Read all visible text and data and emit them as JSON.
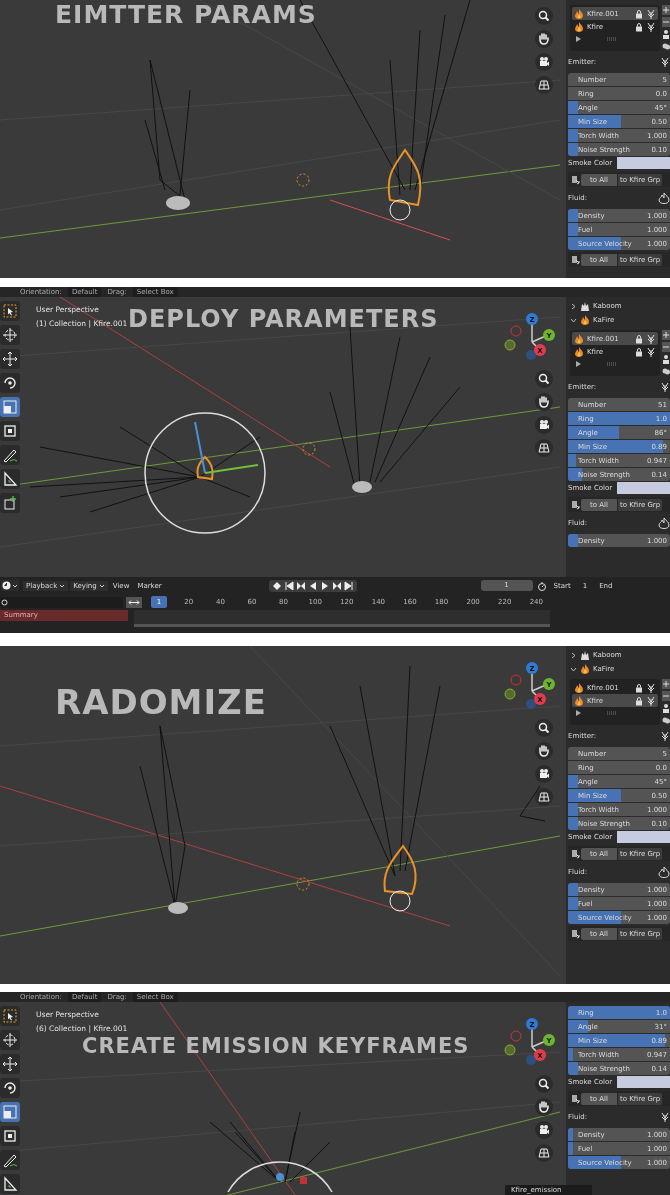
{
  "panels": [
    {
      "title": "EIMTTER PARAMS",
      "sidebar": [
        {
          "kind": "object_list",
          "items": [
            {
              "label": "Kfire.001",
              "selected": true
            },
            {
              "label": "Kfire",
              "selected": false
            }
          ]
        },
        {
          "kind": "heading",
          "label": "Emitter:"
        },
        {
          "kind": "field",
          "label": "Number",
          "value": "5",
          "level": 0
        },
        {
          "kind": "field",
          "label": "Ring",
          "value": "0.0",
          "level": 0
        },
        {
          "kind": "field",
          "label": "Angle",
          "value": "45°",
          "level": 0.1
        },
        {
          "kind": "field",
          "label": "Min Size",
          "value": "0.50",
          "level": 0.52
        },
        {
          "kind": "field",
          "label": "Torch Width",
          "value": "1.000",
          "level": 0.1
        },
        {
          "kind": "field",
          "label": "Noise Strength",
          "value": "0.10",
          "level": 0.1
        },
        {
          "kind": "color",
          "label": "Smoke Color"
        },
        {
          "kind": "buttons",
          "labels": [
            "to All",
            "to Kfire Grp"
          ]
        },
        {
          "kind": "heading",
          "label": "Fluid:"
        },
        {
          "kind": "field",
          "label": "Density",
          "value": "1.000",
          "level": 0.1
        },
        {
          "kind": "field",
          "label": "Fuel",
          "value": "1.000",
          "level": 0.1
        },
        {
          "kind": "field",
          "label": "Source Velocity",
          "value": "1.000",
          "level": 0.52
        },
        {
          "kind": "buttons",
          "labels": [
            "to All",
            "to Kfire Grp"
          ]
        }
      ]
    },
    {
      "toolbar": {
        "orientation_label": "Orientation:",
        "orientation": "Default",
        "drag_label": "Drag:",
        "drag": "Select Box"
      },
      "view_info": [
        "User Perspective",
        "(1) Collection | Kfire.001"
      ],
      "title": "DEPLOY PARAMETERS",
      "gizmo": [
        "Z",
        "Y",
        "X"
      ],
      "tools": [
        {
          "selected": false
        },
        {
          "selected": false
        },
        {
          "selected": false
        },
        {
          "selected": false
        },
        {
          "selected": true
        },
        {
          "selected": false
        },
        {
          "selected": false
        },
        {
          "selected": false
        },
        {
          "selected": false
        }
      ],
      "sidebar": [
        {
          "kind": "collection",
          "label": "Kaboom",
          "expanded": false
        },
        {
          "kind": "collection",
          "label": "KaFire",
          "expanded": true
        },
        {
          "kind": "object_list",
          "items": [
            {
              "label": "Kfire.001",
              "selected": true
            },
            {
              "label": "Kfire",
              "selected": false
            }
          ]
        },
        {
          "kind": "heading",
          "label": "Emitter:"
        },
        {
          "kind": "field",
          "label": "Number",
          "value": "51",
          "level": 0
        },
        {
          "kind": "field",
          "label": "Ring",
          "value": "1.0",
          "level": 1
        },
        {
          "kind": "field",
          "label": "Angle",
          "value": "86°",
          "level": 0.5
        },
        {
          "kind": "field",
          "label": "Min Size",
          "value": "0.89",
          "level": 0.93
        },
        {
          "kind": "field",
          "label": "Torch Width",
          "value": "0.947",
          "level": 0.08
        },
        {
          "kind": "field",
          "label": "Noise Strength",
          "value": "0.14",
          "level": 0.14
        },
        {
          "kind": "color",
          "label": "Smoke Color"
        },
        {
          "kind": "buttons",
          "labels": [
            "to All",
            "to Kfire Grp"
          ]
        },
        {
          "kind": "heading",
          "label": "Fluid:"
        },
        {
          "kind": "field",
          "label": "Density",
          "value": "1.000",
          "level": 0.1
        }
      ],
      "timeline": {
        "menus": [
          {
            "label": "Playback",
            "dropdown": true
          },
          {
            "label": "Keying",
            "dropdown": true
          },
          {
            "label": "View",
            "dropdown": false
          },
          {
            "label": "Marker",
            "dropdown": false
          }
        ],
        "current_frame": "1",
        "start_label": "Start",
        "start": "1",
        "end_label": "End",
        "frame_marker": "1",
        "ruler": [
          "20",
          "40",
          "60",
          "80",
          "100",
          "120",
          "140",
          "160",
          "180",
          "200",
          "220",
          "240"
        ],
        "channels": [
          "Summary"
        ]
      }
    },
    {
      "title": "RADOMIZE",
      "gizmo": [
        "Z",
        "Y",
        "X"
      ],
      "sidebar": [
        {
          "kind": "collection",
          "label": "Kaboom",
          "expanded": false
        },
        {
          "kind": "collection",
          "label": "KaFire",
          "expanded": true
        },
        {
          "kind": "object_list",
          "items": [
            {
              "label": "Kfire.001",
              "selected": false
            },
            {
              "label": "Kfire",
              "selected": true
            }
          ]
        },
        {
          "kind": "heading",
          "label": "Emitter:"
        },
        {
          "kind": "field",
          "label": "Number",
          "value": "5",
          "level": 0
        },
        {
          "kind": "field",
          "label": "Ring",
          "value": "0.0",
          "level": 0
        },
        {
          "kind": "field",
          "label": "Angle",
          "value": "45°",
          "level": 0.1
        },
        {
          "kind": "field",
          "label": "Min Size",
          "value": "0.50",
          "level": 0.52
        },
        {
          "kind": "field",
          "label": "Torch Width",
          "value": "1.000",
          "level": 0.1
        },
        {
          "kind": "field",
          "label": "Noise Strength",
          "value": "0.10",
          "level": 0.1
        },
        {
          "kind": "color",
          "label": "Smoke Color"
        },
        {
          "kind": "buttons",
          "labels": [
            "to All",
            "to Kfire Grp"
          ]
        },
        {
          "kind": "heading",
          "label": "Fluid:"
        },
        {
          "kind": "field",
          "label": "Density",
          "value": "1.000",
          "level": 0.1
        },
        {
          "kind": "field",
          "label": "Fuel",
          "value": "1.000",
          "level": 0.1
        },
        {
          "kind": "field",
          "label": "Source Velocity",
          "value": "1.000",
          "level": 0.52
        },
        {
          "kind": "buttons",
          "labels": [
            "to All",
            "to Kfire Grp"
          ]
        }
      ]
    },
    {
      "toolbar": {
        "orientation_label": "Orientation:",
        "orientation": "Default",
        "drag_label": "Drag:",
        "drag": "Select Box"
      },
      "view_info": [
        "User Perspective",
        "(6) Collection | Kfire.001"
      ],
      "title": "CREATE EMISSION KEYFRAMES",
      "gizmo": [
        "Z",
        "Y",
        "X"
      ],
      "tools": [
        {
          "selected": false
        },
        {
          "selected": false
        },
        {
          "selected": false
        },
        {
          "selected": false
        },
        {
          "selected": true
        },
        {
          "selected": false
        },
        {
          "selected": false
        },
        {
          "selected": false
        }
      ],
      "sidebar": [
        {
          "kind": "field",
          "label": "Ring",
          "value": "1.0",
          "level": 1
        },
        {
          "kind": "field",
          "label": "Angle",
          "value": "31°",
          "level": 0.2
        },
        {
          "kind": "field",
          "label": "Min Size",
          "value": "0.89",
          "level": 0.95
        },
        {
          "kind": "field",
          "label": "Torch Width",
          "value": "0.947",
          "level": 0.05
        },
        {
          "kind": "field",
          "label": "Noise Strength",
          "value": "0.14",
          "level": 0.1
        },
        {
          "kind": "color",
          "label": "Smoke Color"
        },
        {
          "kind": "buttons",
          "labels": [
            "to All",
            "to Kfire Grp"
          ]
        },
        {
          "kind": "heading",
          "label": "Fluid:"
        },
        {
          "kind": "field",
          "label": "Density",
          "value": "1.000",
          "level": 0.05
        },
        {
          "kind": "field",
          "label": "Fuel",
          "value": "1.000",
          "level": 0.05
        },
        {
          "kind": "field",
          "label": "Source Velocity",
          "value": "1.000",
          "level": 0.52
        }
      ],
      "tooltip": "Kfire_emission"
    }
  ]
}
